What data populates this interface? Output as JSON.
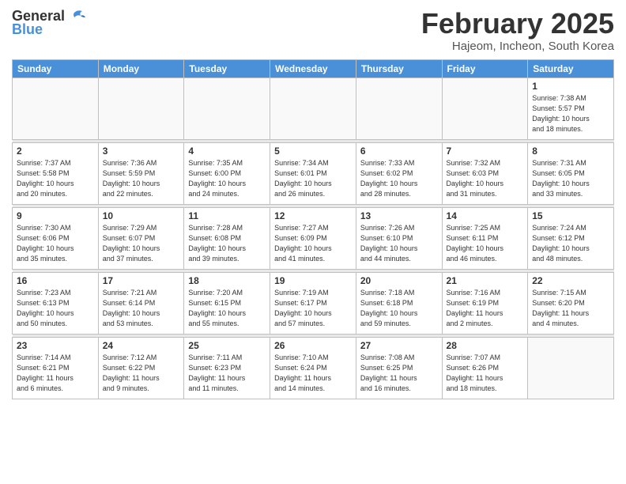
{
  "header": {
    "logo_general": "General",
    "logo_blue": "Blue",
    "month_title": "February 2025",
    "subtitle": "Hajeom, Incheon, South Korea"
  },
  "weekdays": [
    "Sunday",
    "Monday",
    "Tuesday",
    "Wednesday",
    "Thursday",
    "Friday",
    "Saturday"
  ],
  "weeks": [
    [
      {
        "day": "",
        "info": ""
      },
      {
        "day": "",
        "info": ""
      },
      {
        "day": "",
        "info": ""
      },
      {
        "day": "",
        "info": ""
      },
      {
        "day": "",
        "info": ""
      },
      {
        "day": "",
        "info": ""
      },
      {
        "day": "1",
        "info": "Sunrise: 7:38 AM\nSunset: 5:57 PM\nDaylight: 10 hours\nand 18 minutes."
      }
    ],
    [
      {
        "day": "2",
        "info": "Sunrise: 7:37 AM\nSunset: 5:58 PM\nDaylight: 10 hours\nand 20 minutes."
      },
      {
        "day": "3",
        "info": "Sunrise: 7:36 AM\nSunset: 5:59 PM\nDaylight: 10 hours\nand 22 minutes."
      },
      {
        "day": "4",
        "info": "Sunrise: 7:35 AM\nSunset: 6:00 PM\nDaylight: 10 hours\nand 24 minutes."
      },
      {
        "day": "5",
        "info": "Sunrise: 7:34 AM\nSunset: 6:01 PM\nDaylight: 10 hours\nand 26 minutes."
      },
      {
        "day": "6",
        "info": "Sunrise: 7:33 AM\nSunset: 6:02 PM\nDaylight: 10 hours\nand 28 minutes."
      },
      {
        "day": "7",
        "info": "Sunrise: 7:32 AM\nSunset: 6:03 PM\nDaylight: 10 hours\nand 31 minutes."
      },
      {
        "day": "8",
        "info": "Sunrise: 7:31 AM\nSunset: 6:05 PM\nDaylight: 10 hours\nand 33 minutes."
      }
    ],
    [
      {
        "day": "9",
        "info": "Sunrise: 7:30 AM\nSunset: 6:06 PM\nDaylight: 10 hours\nand 35 minutes."
      },
      {
        "day": "10",
        "info": "Sunrise: 7:29 AM\nSunset: 6:07 PM\nDaylight: 10 hours\nand 37 minutes."
      },
      {
        "day": "11",
        "info": "Sunrise: 7:28 AM\nSunset: 6:08 PM\nDaylight: 10 hours\nand 39 minutes."
      },
      {
        "day": "12",
        "info": "Sunrise: 7:27 AM\nSunset: 6:09 PM\nDaylight: 10 hours\nand 41 minutes."
      },
      {
        "day": "13",
        "info": "Sunrise: 7:26 AM\nSunset: 6:10 PM\nDaylight: 10 hours\nand 44 minutes."
      },
      {
        "day": "14",
        "info": "Sunrise: 7:25 AM\nSunset: 6:11 PM\nDaylight: 10 hours\nand 46 minutes."
      },
      {
        "day": "15",
        "info": "Sunrise: 7:24 AM\nSunset: 6:12 PM\nDaylight: 10 hours\nand 48 minutes."
      }
    ],
    [
      {
        "day": "16",
        "info": "Sunrise: 7:23 AM\nSunset: 6:13 PM\nDaylight: 10 hours\nand 50 minutes."
      },
      {
        "day": "17",
        "info": "Sunrise: 7:21 AM\nSunset: 6:14 PM\nDaylight: 10 hours\nand 53 minutes."
      },
      {
        "day": "18",
        "info": "Sunrise: 7:20 AM\nSunset: 6:15 PM\nDaylight: 10 hours\nand 55 minutes."
      },
      {
        "day": "19",
        "info": "Sunrise: 7:19 AM\nSunset: 6:17 PM\nDaylight: 10 hours\nand 57 minutes."
      },
      {
        "day": "20",
        "info": "Sunrise: 7:18 AM\nSunset: 6:18 PM\nDaylight: 10 hours\nand 59 minutes."
      },
      {
        "day": "21",
        "info": "Sunrise: 7:16 AM\nSunset: 6:19 PM\nDaylight: 11 hours\nand 2 minutes."
      },
      {
        "day": "22",
        "info": "Sunrise: 7:15 AM\nSunset: 6:20 PM\nDaylight: 11 hours\nand 4 minutes."
      }
    ],
    [
      {
        "day": "23",
        "info": "Sunrise: 7:14 AM\nSunset: 6:21 PM\nDaylight: 11 hours\nand 6 minutes."
      },
      {
        "day": "24",
        "info": "Sunrise: 7:12 AM\nSunset: 6:22 PM\nDaylight: 11 hours\nand 9 minutes."
      },
      {
        "day": "25",
        "info": "Sunrise: 7:11 AM\nSunset: 6:23 PM\nDaylight: 11 hours\nand 11 minutes."
      },
      {
        "day": "26",
        "info": "Sunrise: 7:10 AM\nSunset: 6:24 PM\nDaylight: 11 hours\nand 14 minutes."
      },
      {
        "day": "27",
        "info": "Sunrise: 7:08 AM\nSunset: 6:25 PM\nDaylight: 11 hours\nand 16 minutes."
      },
      {
        "day": "28",
        "info": "Sunrise: 7:07 AM\nSunset: 6:26 PM\nDaylight: 11 hours\nand 18 minutes."
      },
      {
        "day": "",
        "info": ""
      }
    ]
  ]
}
